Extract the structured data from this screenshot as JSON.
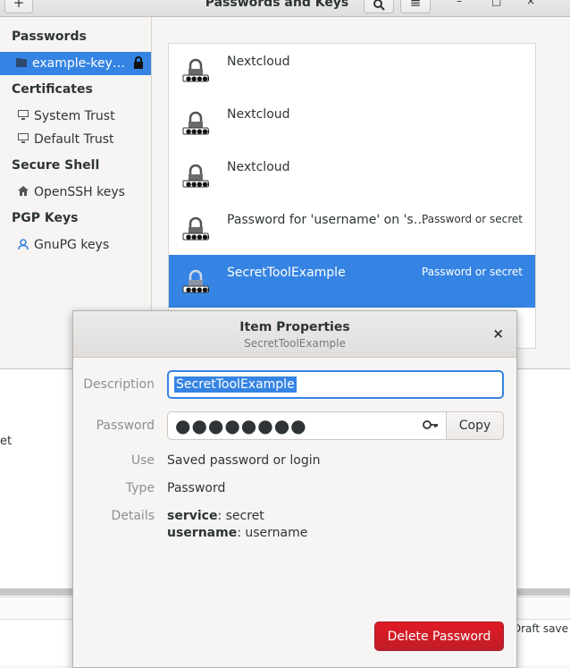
{
  "window": {
    "title": "Passwords and Keys",
    "add_glyph": "+",
    "search_glyph": "⌕",
    "menu_glyph": "≡",
    "minimize_glyph": "–",
    "maximize_glyph": "□",
    "close_glyph": "×"
  },
  "sidebar": {
    "sections": [
      {
        "heading": "Passwords",
        "items": [
          {
            "label": "example-key…",
            "icon": "folder-icon",
            "selected": true,
            "locked": true
          }
        ]
      },
      {
        "heading": "Certificates",
        "items": [
          {
            "label": "System Trust",
            "icon": "computer-icon"
          },
          {
            "label": "Default Trust",
            "icon": "computer-icon"
          }
        ]
      },
      {
        "heading": "Secure Shell",
        "items": [
          {
            "label": "OpenSSH keys",
            "icon": "home-icon"
          }
        ]
      },
      {
        "heading": "PGP Keys",
        "items": [
          {
            "label": "GnuPG keys",
            "icon": "person-icon"
          }
        ]
      }
    ]
  },
  "list": {
    "items": [
      {
        "name": "Nextcloud",
        "kind": ""
      },
      {
        "name": "Nextcloud",
        "kind": ""
      },
      {
        "name": "Nextcloud",
        "kind": ""
      },
      {
        "name": "Password for 'username' on 's…",
        "kind": "Password or secret"
      },
      {
        "name": "SecretToolExample",
        "kind": "Password or secret",
        "selected": true
      }
    ]
  },
  "background": {
    "fragment": "et",
    "status": "Draft save"
  },
  "dialog": {
    "title": "Item Properties",
    "subtitle": "SecretToolExample",
    "close_glyph": "×",
    "description_label": "Description",
    "description_value": "SecretToolExample",
    "password_label": "Password",
    "password_value": "●●●●●●●●",
    "copy_label": "Copy",
    "use_label": "Use",
    "use_value": "Saved password or login",
    "type_label": "Type",
    "type_value": "Password",
    "details_label": "Details",
    "details": [
      {
        "key": "service",
        "value": ": secret"
      },
      {
        "key": "username",
        "value": ": username"
      }
    ],
    "delete_label": "Delete Password"
  },
  "colors": {
    "accent": "#3584e4",
    "destructive": "#e01b24"
  }
}
